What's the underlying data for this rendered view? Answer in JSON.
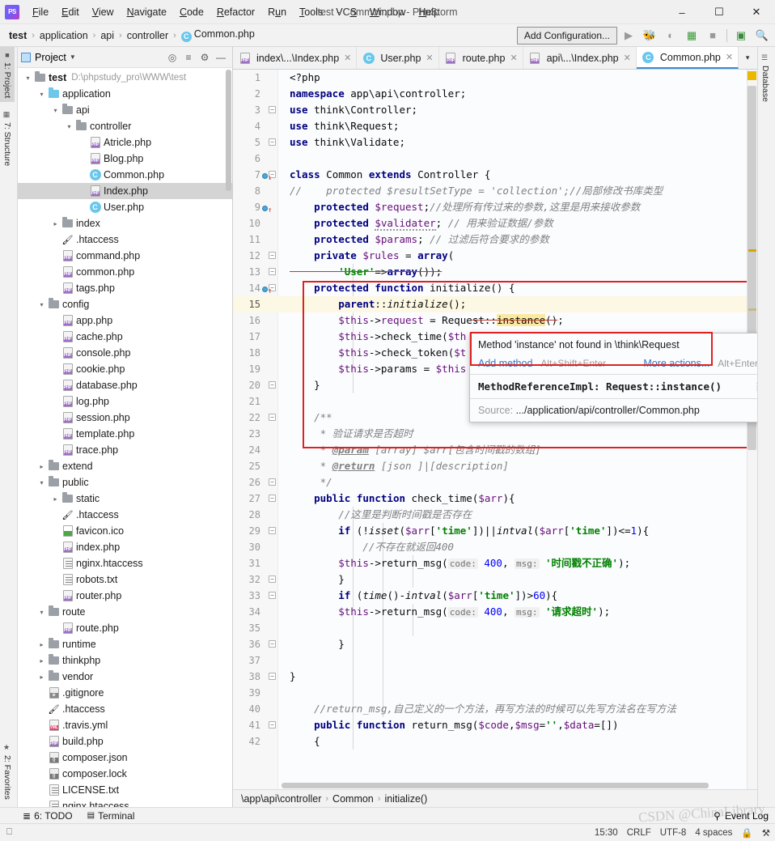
{
  "window": {
    "title": "test - Common.php - PhpStorm",
    "app_badge": "PS",
    "minimize": "–",
    "maximize": "☐",
    "close": "✕"
  },
  "menu": [
    {
      "label": "File"
    },
    {
      "label": "Edit"
    },
    {
      "label": "View"
    },
    {
      "label": "Navigate"
    },
    {
      "label": "Code"
    },
    {
      "label": "Refactor"
    },
    {
      "label": "Run"
    },
    {
      "label": "Tools"
    },
    {
      "label": "VCS"
    },
    {
      "label": "Window"
    },
    {
      "label": "Help"
    }
  ],
  "breadcrumb": {
    "items": [
      "test",
      "application",
      "api",
      "controller",
      "Common.php"
    ],
    "separator": "›",
    "class_badge": "C"
  },
  "navbar": {
    "add_configuration": "Add Configuration...",
    "icons": [
      "run-icon",
      "debug-icon",
      "run-with-coverage-icon",
      "profile-icon",
      "stop-icon",
      "separator",
      "terminal-icon",
      "search-everywhere-icon"
    ]
  },
  "left_strip": {
    "top": [
      {
        "label": "1: Project",
        "icon": "project-icon",
        "active": true
      },
      {
        "label": "7: Structure",
        "icon": "structure-icon",
        "active": false
      }
    ],
    "bottom": [
      {
        "label": "2: Favorites",
        "icon": "star-icon",
        "active": false
      }
    ]
  },
  "right_strip": {
    "items": [
      {
        "label": "Database",
        "icon": "database-icon"
      }
    ]
  },
  "project_panel": {
    "title": "Project",
    "caret": "▼",
    "toolbar_icons": [
      "locate-icon",
      "collapse-all-icon",
      "settings-gear-icon",
      "hide-icon"
    ],
    "tree": [
      {
        "depth": 0,
        "arrow": "v",
        "icon": "folder",
        "label": "test",
        "bold": true,
        "path": "D:\\phpstudy_pro\\WWW\\test"
      },
      {
        "depth": 1,
        "arrow": "v",
        "icon": "folder-blue",
        "label": "application"
      },
      {
        "depth": 2,
        "arrow": "v",
        "icon": "folder",
        "label": "api"
      },
      {
        "depth": 3,
        "arrow": "v",
        "icon": "folder",
        "label": "controller"
      },
      {
        "depth": 4,
        "arrow": "",
        "icon": "php",
        "label": "Atricle.php"
      },
      {
        "depth": 4,
        "arrow": "",
        "icon": "php",
        "label": "Blog.php"
      },
      {
        "depth": 4,
        "arrow": "",
        "icon": "class",
        "label": "Common.php"
      },
      {
        "depth": 4,
        "arrow": "",
        "icon": "php",
        "label": "Index.php",
        "selected": true
      },
      {
        "depth": 4,
        "arrow": "",
        "icon": "class",
        "label": "User.php"
      },
      {
        "depth": 2,
        "arrow": ">",
        "icon": "folder",
        "label": "index"
      },
      {
        "depth": 2,
        "arrow": "",
        "icon": "htaccess",
        "label": ".htaccess"
      },
      {
        "depth": 2,
        "arrow": "",
        "icon": "php",
        "label": "command.php"
      },
      {
        "depth": 2,
        "arrow": "",
        "icon": "php",
        "label": "common.php"
      },
      {
        "depth": 2,
        "arrow": "",
        "icon": "php",
        "label": "tags.php"
      },
      {
        "depth": 1,
        "arrow": "v",
        "icon": "folder",
        "label": "config"
      },
      {
        "depth": 2,
        "arrow": "",
        "icon": "php",
        "label": "app.php"
      },
      {
        "depth": 2,
        "arrow": "",
        "icon": "php",
        "label": "cache.php"
      },
      {
        "depth": 2,
        "arrow": "",
        "icon": "php",
        "label": "console.php"
      },
      {
        "depth": 2,
        "arrow": "",
        "icon": "php",
        "label": "cookie.php"
      },
      {
        "depth": 2,
        "arrow": "",
        "icon": "php",
        "label": "database.php"
      },
      {
        "depth": 2,
        "arrow": "",
        "icon": "php",
        "label": "log.php"
      },
      {
        "depth": 2,
        "arrow": "",
        "icon": "php",
        "label": "session.php"
      },
      {
        "depth": 2,
        "arrow": "",
        "icon": "php",
        "label": "template.php"
      },
      {
        "depth": 2,
        "arrow": "",
        "icon": "php",
        "label": "trace.php"
      },
      {
        "depth": 1,
        "arrow": ">",
        "icon": "folder",
        "label": "extend"
      },
      {
        "depth": 1,
        "arrow": "v",
        "icon": "folder",
        "label": "public"
      },
      {
        "depth": 2,
        "arrow": ">",
        "icon": "folder",
        "label": "static"
      },
      {
        "depth": 2,
        "arrow": "",
        "icon": "htaccess",
        "label": ".htaccess"
      },
      {
        "depth": 2,
        "arrow": "",
        "icon": "image",
        "label": "favicon.ico"
      },
      {
        "depth": 2,
        "arrow": "",
        "icon": "php",
        "label": "index.php"
      },
      {
        "depth": 2,
        "arrow": "",
        "icon": "txt",
        "label": "nginx.htaccess"
      },
      {
        "depth": 2,
        "arrow": "",
        "icon": "txt",
        "label": "robots.txt"
      },
      {
        "depth": 2,
        "arrow": "",
        "icon": "php",
        "label": "router.php"
      },
      {
        "depth": 1,
        "arrow": "v",
        "icon": "folder",
        "label": "route"
      },
      {
        "depth": 2,
        "arrow": "",
        "icon": "php",
        "label": "route.php"
      },
      {
        "depth": 1,
        "arrow": ">",
        "icon": "folder",
        "label": "runtime"
      },
      {
        "depth": 1,
        "arrow": ">",
        "icon": "folder",
        "label": "thinkphp"
      },
      {
        "depth": 1,
        "arrow": ">",
        "icon": "folder",
        "label": "vendor"
      },
      {
        "depth": 1,
        "arrow": "",
        "icon": "gitignore",
        "label": ".gitignore"
      },
      {
        "depth": 1,
        "arrow": "",
        "icon": "htaccess",
        "label": ".htaccess"
      },
      {
        "depth": 1,
        "arrow": "",
        "icon": "yml",
        "label": ".travis.yml"
      },
      {
        "depth": 1,
        "arrow": "",
        "icon": "php",
        "label": "build.php"
      },
      {
        "depth": 1,
        "arrow": "",
        "icon": "json",
        "label": "composer.json"
      },
      {
        "depth": 1,
        "arrow": "",
        "icon": "json",
        "label": "composer.lock"
      },
      {
        "depth": 1,
        "arrow": "",
        "icon": "txt",
        "label": "LICENSE.txt"
      },
      {
        "depth": 1,
        "arrow": "",
        "icon": "txt",
        "label": "nginx.htaccess"
      }
    ]
  },
  "tabs": [
    {
      "label": "index\\...\\Index.php",
      "icon": "php",
      "active": false
    },
    {
      "label": "User.php",
      "icon": "class",
      "active": false
    },
    {
      "label": "route.php",
      "icon": "php",
      "active": false
    },
    {
      "label": "api\\...\\Index.php",
      "icon": "php",
      "active": false
    },
    {
      "label": "Common.php",
      "icon": "class",
      "active": true
    }
  ],
  "editor": {
    "current_line": 15,
    "first_line": 1,
    "last_line": 42,
    "lines": [
      {
        "n": 1,
        "text": "<?php"
      },
      {
        "n": 2,
        "text": "namespace app\\api\\controller;"
      },
      {
        "n": 3,
        "text": "use think\\Controller;"
      },
      {
        "n": 4,
        "text": "use think\\Request;"
      },
      {
        "n": 5,
        "text": "use think\\Validate;"
      },
      {
        "n": 6,
        "text": ""
      },
      {
        "n": 7,
        "text": "class Common extends Controller {"
      },
      {
        "n": 8,
        "text": "//    protected $resultSetType = 'collection';//局部修改书库类型"
      },
      {
        "n": 9,
        "text": "    protected $request;//处理所有传过来的参数,这里是用来接收参数"
      },
      {
        "n": 10,
        "text": "    protected $validater; // 用来验证数据/参数"
      },
      {
        "n": 11,
        "text": "    protected $params; // 过滤后符合要求的参数"
      },
      {
        "n": 12,
        "text": "    private $rules = array("
      },
      {
        "n": 13,
        "text": "        'User'=>array());"
      },
      {
        "n": 14,
        "text": "    protected function initialize() {"
      },
      {
        "n": 15,
        "text": "        parent::initialize();"
      },
      {
        "n": 16,
        "text": "        $this->request = Request::instance();"
      },
      {
        "n": 17,
        "text": "        $this->check_time($th"
      },
      {
        "n": 18,
        "text": "        $this->check_token($t"
      },
      {
        "n": 19,
        "text": "        $this->params = $this"
      },
      {
        "n": 20,
        "text": "    }"
      },
      {
        "n": 21,
        "text": ""
      },
      {
        "n": 22,
        "text": "    /**"
      },
      {
        "n": 23,
        "text": "     * 验证请求是否超时"
      },
      {
        "n": 24,
        "text": "     * @param [array] $arr[包含时间戳的数组]"
      },
      {
        "n": 25,
        "text": "     * @return [json ]|[description]"
      },
      {
        "n": 26,
        "text": "     */"
      },
      {
        "n": 27,
        "text": "    public function check_time($arr){"
      },
      {
        "n": 28,
        "text": "        //这里是判断时间戳是否存在"
      },
      {
        "n": 29,
        "text": "        if (!isset($arr['time'])||intval($arr['time'])<=1){"
      },
      {
        "n": 30,
        "text": "            //不存在就返回400"
      },
      {
        "n": 31,
        "text": "            $this->return_msg( code: 400, msg: '时间戳不正确');"
      },
      {
        "n": 32,
        "text": "        }"
      },
      {
        "n": 33,
        "text": "        if (time()-intval($arr['time'])>60){"
      },
      {
        "n": 34,
        "text": "            $this->return_msg( code: 400, msg: '请求超时');"
      },
      {
        "n": 35,
        "text": ""
      },
      {
        "n": 36,
        "text": "        }"
      },
      {
        "n": 37,
        "text": ""
      },
      {
        "n": 38,
        "text": "}"
      },
      {
        "n": 39,
        "text": ""
      },
      {
        "n": 40,
        "text": "    //return_msg,自己定义的一个方法，再写方法的时候可以先写方法名在写方法"
      },
      {
        "n": 41,
        "text": "    public function return_msg($code,$msg='',$data=[])"
      },
      {
        "n": 42,
        "text": "    {"
      }
    ],
    "crumbs": [
      "\\app\\api\\controller",
      "Common",
      "initialize()"
    ],
    "crumb_separator": "›"
  },
  "popup": {
    "message": "Method 'instance' not found in \\think\\Request",
    "action_link": "Add method",
    "action_shortcut": "Alt+Shift+Enter",
    "more_actions": "More actions...",
    "more_shortcut": "Alt+Enter",
    "reference": "MethodReferenceImpl: Request::instance()",
    "source_label": "Source:",
    "source_value": ".../application/api/controller/Common.php"
  },
  "bottom_bar": {
    "items": [
      {
        "label": "6: TODO",
        "icon": "todo-icon"
      },
      {
        "label": "Terminal",
        "icon": "terminal-icon"
      }
    ],
    "event_log": "Event Log"
  },
  "statusbar": {
    "time": "15:30",
    "line_separator": "CRLF",
    "encoding": "UTF-8",
    "indent": "4 spaces",
    "icons": [
      "line-separator-icon",
      "lock-icon",
      "inspection-icon"
    ]
  },
  "watermark": "CSDN @ChinaLibrary",
  "colors": {
    "accent": "#3d8bdd",
    "error": "#e02020",
    "keyword": "#000080",
    "string": "#008000",
    "variable": "#660e7a",
    "comment": "#808080",
    "current_line": "#fdf8e3",
    "selection": "#d4d4d4"
  }
}
